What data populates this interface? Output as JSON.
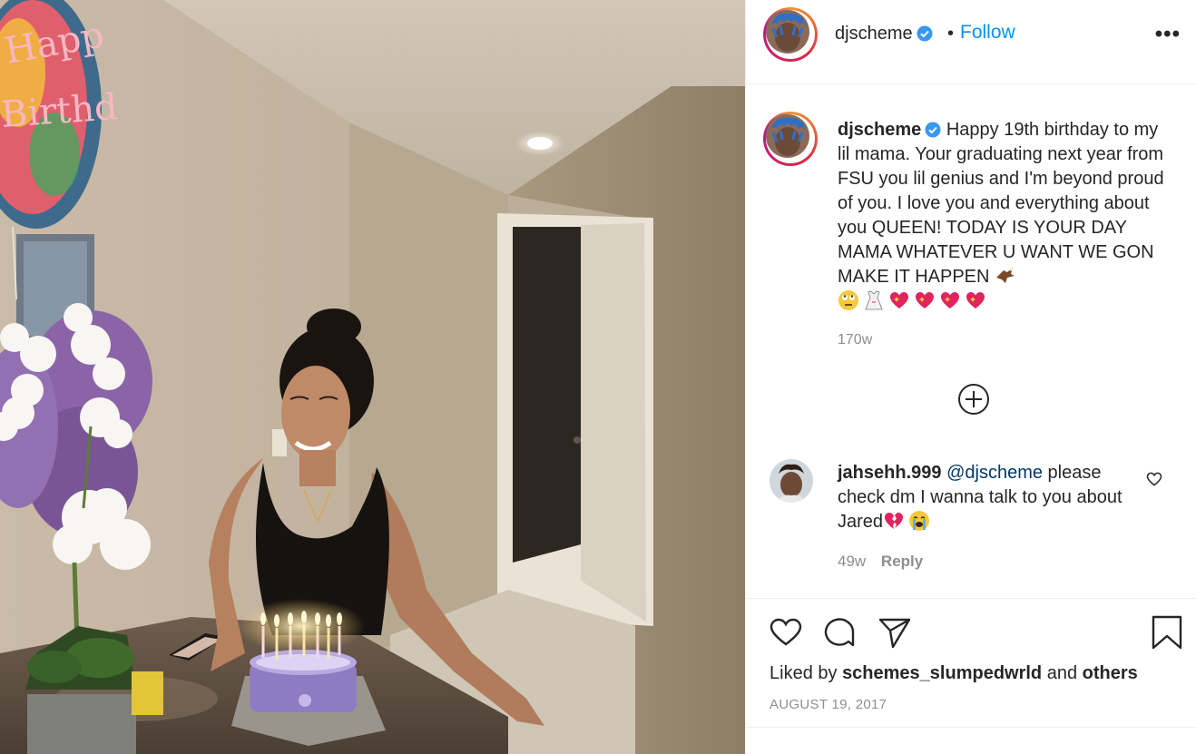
{
  "post": {
    "username": "djscheme",
    "separator": "•",
    "follow_label": "Follow",
    "more_label": "•••"
  },
  "caption": {
    "username": "djscheme",
    "text": "Happy 19th birthday to my lil mama. Your graduating next year from FSU you lil genius and I'm beyond proud of you. I love you and everything about you QUEEN! TODAY IS YOUR DAY MAMA WHATEVER U WANT WE GON MAKE IT HAPPEN",
    "emojis": [
      "eagle-emoji",
      "rolling-eyes-emoji",
      "dress-emoji",
      "sparkling-heart-emoji",
      "sparkling-heart-emoji",
      "sparkling-heart-emoji",
      "sparkling-heart-emoji"
    ],
    "age": "170w"
  },
  "comment": {
    "username": "jahsehh.999",
    "mention": "@djscheme",
    "text": "please check dm I wanna talk to you about Jared",
    "emojis": [
      "broken-heart-emoji",
      "loudly-crying-emoji"
    ],
    "age": "49w",
    "reply_label": "Reply"
  },
  "footer": {
    "liked_prefix": "Liked by",
    "liked_user": "schemes_slumpedwrld",
    "liked_and": "and",
    "liked_others": "others",
    "date": "AUGUST 19, 2017"
  },
  "icons": {
    "verified": "verified-badge-icon",
    "load_more": "plus-circle-icon",
    "like": "heart-icon",
    "comment": "comment-bubble-icon",
    "share": "paper-plane-icon",
    "save": "bookmark-icon"
  },
  "colors": {
    "follow": "#0095f6",
    "verified": "#3897f0",
    "mention": "#00376b",
    "secondary_text": "#8e8e8e"
  }
}
